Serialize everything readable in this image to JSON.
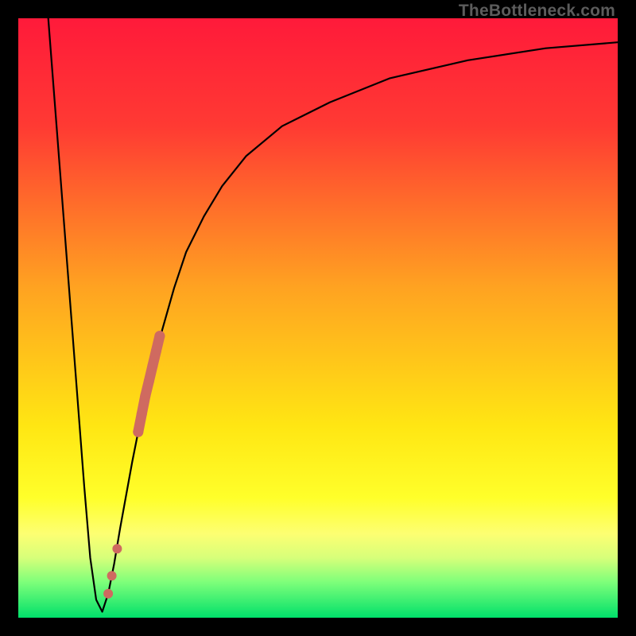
{
  "watermark": {
    "text": "TheBottleneck.com"
  },
  "colors": {
    "frame": "#000000",
    "curve": "#000000",
    "marker": "#cf6a60",
    "gradient_stops": [
      {
        "pct": 0,
        "color": "#ff1a3a"
      },
      {
        "pct": 18,
        "color": "#ff3a33"
      },
      {
        "pct": 45,
        "color": "#ffa321"
      },
      {
        "pct": 68,
        "color": "#ffe613"
      },
      {
        "pct": 80,
        "color": "#ffff2a"
      },
      {
        "pct": 86,
        "color": "#fdff72"
      },
      {
        "pct": 90,
        "color": "#d7ff7a"
      },
      {
        "pct": 94,
        "color": "#7fff7a"
      },
      {
        "pct": 100,
        "color": "#00e06a"
      }
    ]
  },
  "chart_data": {
    "type": "line",
    "title": "",
    "xlabel": "",
    "ylabel": "",
    "xlim": [
      0,
      100
    ],
    "ylim": [
      0,
      100
    ],
    "series": [
      {
        "name": "bottleneck-curve",
        "x": [
          5,
          7,
          9,
          11,
          12,
          13,
          14,
          15,
          16,
          17,
          19,
          21,
          24,
          26,
          28,
          31,
          34,
          38,
          44,
          52,
          62,
          75,
          88,
          100
        ],
        "y": [
          100,
          74,
          48,
          22,
          10,
          3,
          1,
          4,
          9,
          15,
          26,
          36,
          48,
          55,
          61,
          67,
          72,
          77,
          82,
          86,
          90,
          93,
          95,
          96
        ]
      }
    ],
    "markers": {
      "name": "highlight-segment",
      "points": [
        {
          "x": 15.0,
          "y": 4.0
        },
        {
          "x": 15.6,
          "y": 7.0
        },
        {
          "x": 16.5,
          "y": 11.5
        },
        {
          "x": 20.0,
          "y": 31.0
        },
        {
          "x": 20.6,
          "y": 34.0
        },
        {
          "x": 21.2,
          "y": 37.0
        },
        {
          "x": 21.8,
          "y": 39.5
        },
        {
          "x": 22.4,
          "y": 42.0
        },
        {
          "x": 23.0,
          "y": 44.5
        },
        {
          "x": 23.6,
          "y": 47.0
        }
      ]
    }
  }
}
